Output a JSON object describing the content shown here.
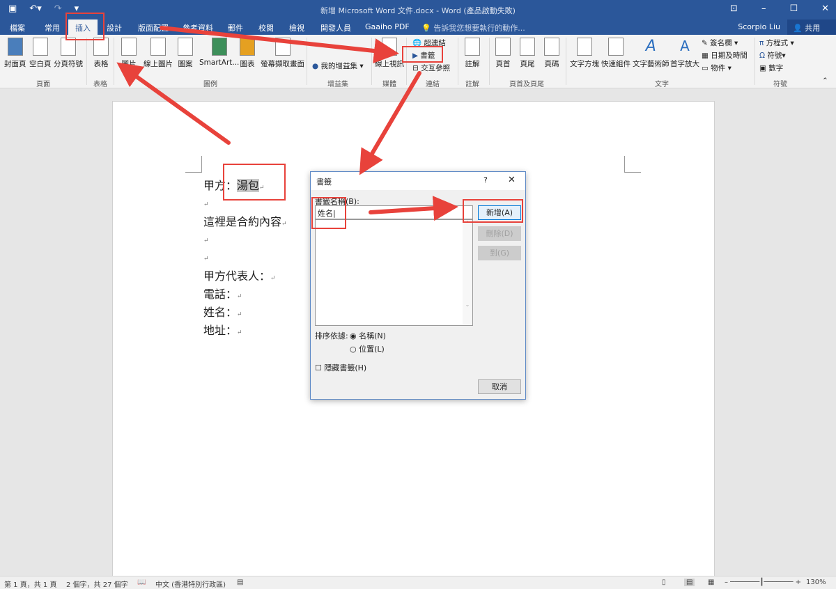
{
  "window": {
    "title": "新增 Microsoft Word 文件.docx - Word (產品啟動失敗)",
    "user": "Scorpio Liu",
    "share": "共用"
  },
  "tabs": [
    "檔案",
    "常用",
    "插入",
    "設計",
    "版面配置",
    "參考資料",
    "郵件",
    "校閱",
    "檢視",
    "開發人員",
    "Gaaiho PDF"
  ],
  "tell_me": "告訴我您想要執行的動作...",
  "ribbon": {
    "pages": {
      "label": "頁面",
      "items": [
        "封面頁",
        "空白頁",
        "分頁符號"
      ]
    },
    "tables": {
      "label": "表格",
      "items": [
        "表格"
      ]
    },
    "illustrations": {
      "label": "圖例",
      "items": [
        "圖片",
        "線上圖片",
        "圖案",
        "SmartArt...",
        "圖表",
        "螢幕擷取畫面"
      ]
    },
    "addins": {
      "label": "增益集",
      "items": [
        "我的增益集"
      ]
    },
    "media": {
      "label": "媒體",
      "items": [
        "線上視訊"
      ]
    },
    "links": {
      "label": "連結",
      "items": [
        "超連結",
        "書籤",
        "交互參照"
      ]
    },
    "comments": {
      "label": "註解",
      "items": [
        "註解"
      ]
    },
    "header_footer": {
      "label": "頁首及頁尾",
      "items": [
        "頁首",
        "頁尾",
        "頁碼"
      ]
    },
    "text": {
      "label": "文字",
      "items": [
        "文字方塊",
        "快速組件",
        "文字藝術師",
        "首字放大",
        "簽名欄",
        "日期及時間",
        "物件"
      ]
    },
    "symbols": {
      "label": "符號",
      "items": [
        "方程式",
        "符號",
        "數字"
      ]
    }
  },
  "document": {
    "lines": [
      "甲方：",
      "",
      "這裡是合約內容",
      "",
      "",
      "甲方代表人：",
      "電話：",
      "姓名：",
      "地址："
    ],
    "highlighted": "湯包"
  },
  "dialog": {
    "title": "書籤",
    "help": "?",
    "name_label": "書籤名稱(B):",
    "name_value": "姓名",
    "add": "新增(A)",
    "delete": "刪除(D)",
    "goto": "到(G)",
    "sort_label": "排序依據:",
    "sort_name": "名稱(N)",
    "sort_location": "位置(L)",
    "hidden": "隱藏書籤(H)",
    "cancel": "取消"
  },
  "status": {
    "page": "第 1 頁，共 1 頁",
    "words": "2 個字，共 27 個字",
    "language": "中文 (香港特別行政區)",
    "zoom": "130%"
  },
  "colors": {
    "brand": "#2b579a",
    "annotation": "#e8423b"
  }
}
